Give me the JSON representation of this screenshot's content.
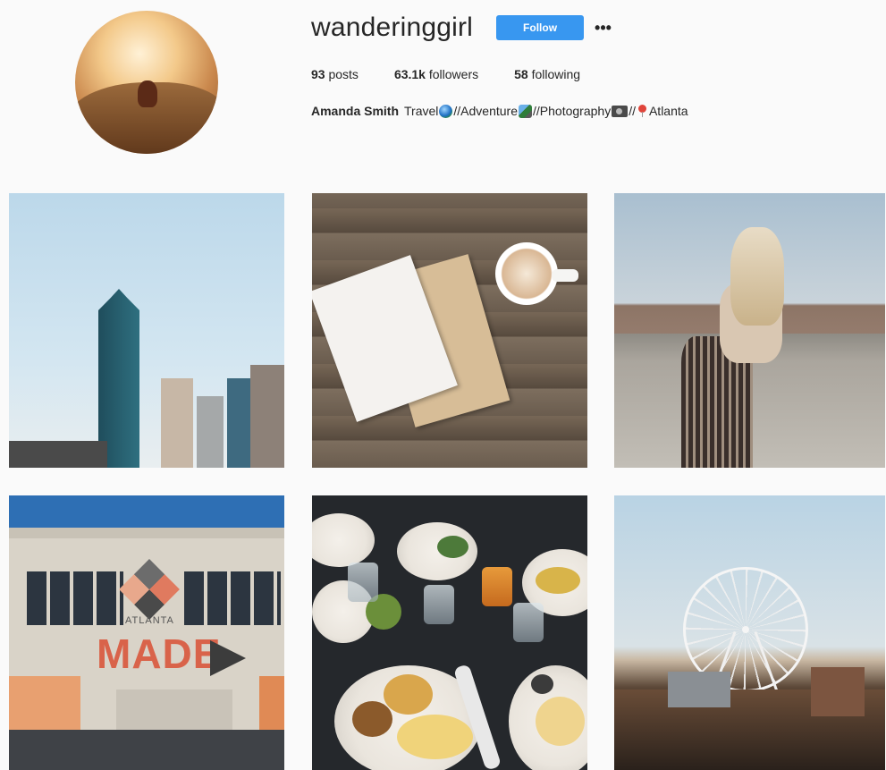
{
  "profile": {
    "username": "wanderinggirl",
    "follow_label": "Follow",
    "more_icon": "more-dots-icon",
    "stats": {
      "posts_count": "93",
      "posts_label": "posts",
      "followers_count": "63.1k",
      "followers_label": "followers",
      "following_count": "58",
      "following_label": "following"
    },
    "bio": {
      "name": "Amanda Smith",
      "seg1": "Travel",
      "seg2": "//Adventure",
      "seg3": "//Photography",
      "seg4": "//",
      "seg5": "Atlanta"
    }
  },
  "posts": [
    {
      "subject": "city-skyline-photo"
    },
    {
      "subject": "coffee-and-notebook-photo"
    },
    {
      "subject": "woman-on-rooftop-photo"
    },
    {
      "subject": "atlanta-made-mural-photo"
    },
    {
      "subject": "brunch-table-photo"
    },
    {
      "subject": "ferris-wheel-photo"
    }
  ],
  "colors": {
    "follow_button": "#3897f0",
    "background": "#fafafa",
    "text": "#262626"
  }
}
